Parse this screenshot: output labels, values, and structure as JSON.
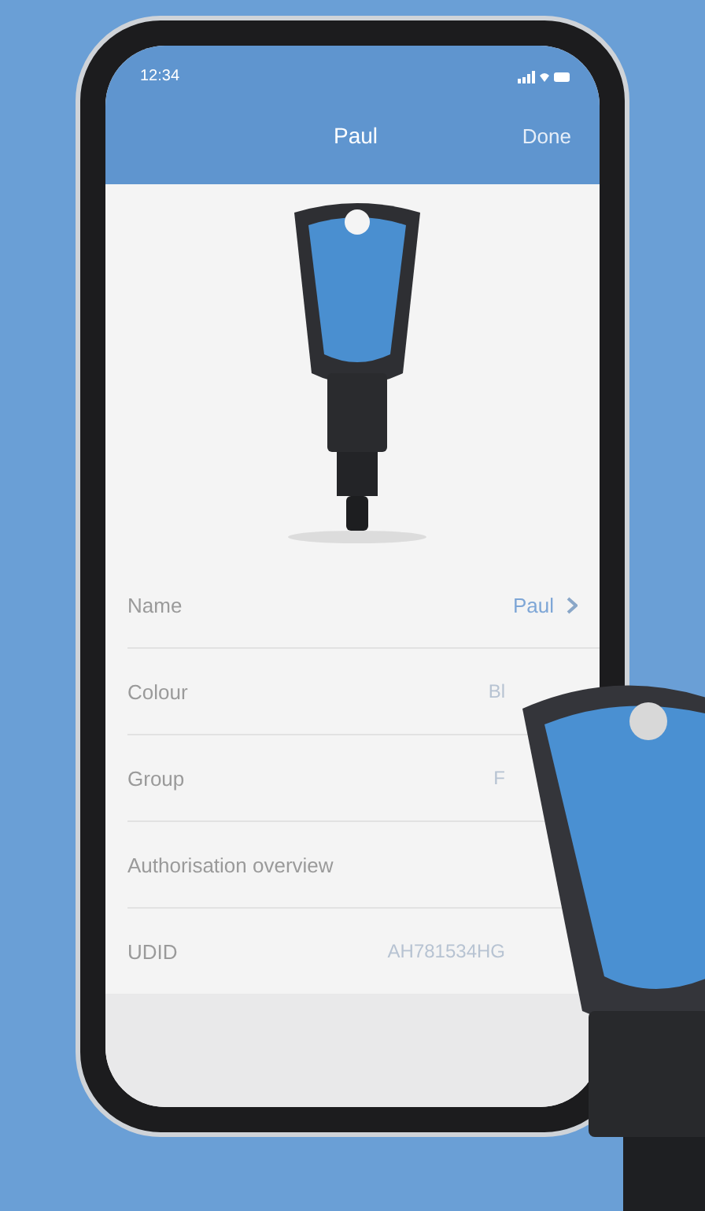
{
  "status_bar": {
    "time": "12:34"
  },
  "nav_bar": {
    "title": "Paul",
    "action": "Done"
  },
  "rows": [
    {
      "label": "Name",
      "value": "Paul",
      "chevron": true
    },
    {
      "label": "Colour",
      "value": "Bl",
      "chevron": false
    },
    {
      "label": "Group",
      "value": "F",
      "chevron": false
    },
    {
      "label": "Authorisation overview",
      "chevron": false
    },
    {
      "label": "UDID",
      "value": "AH781534HG",
      "chevron": false
    }
  ]
}
